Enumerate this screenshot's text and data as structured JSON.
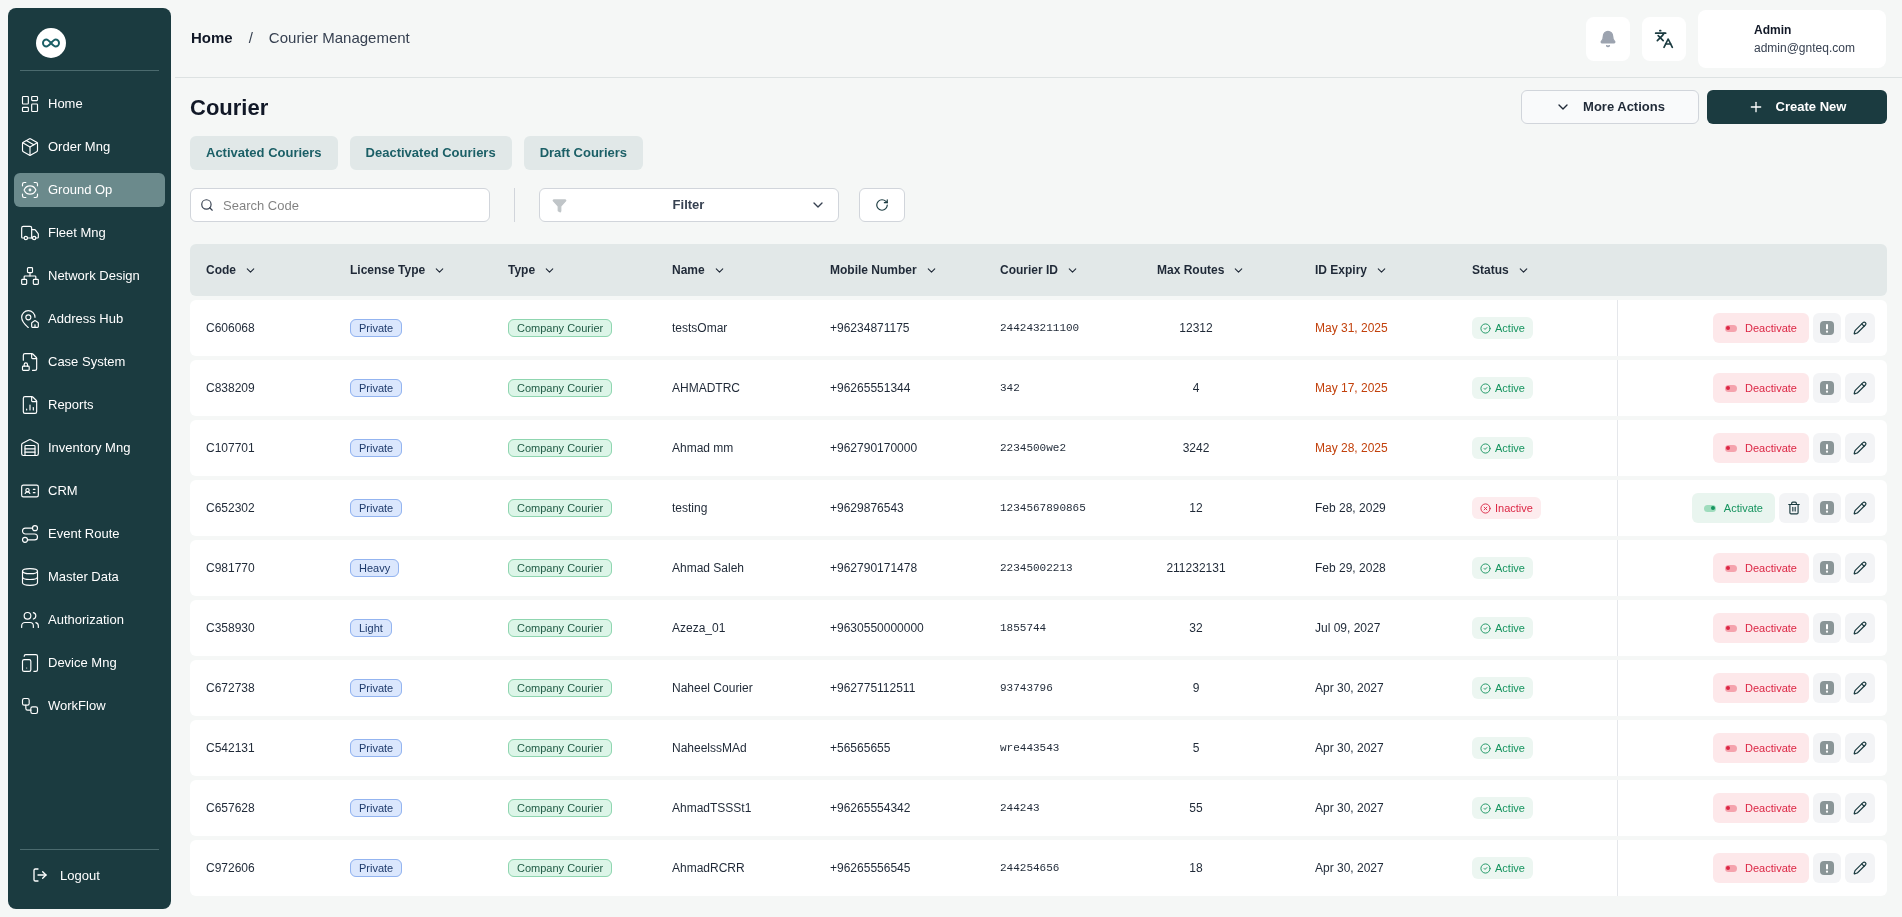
{
  "sidebar": {
    "items": [
      {
        "label": "Home",
        "selected": false
      },
      {
        "label": "Order Mng",
        "selected": false
      },
      {
        "label": "Ground Op",
        "selected": true
      },
      {
        "label": "Fleet Mng",
        "selected": false
      },
      {
        "label": "Network Design",
        "selected": false
      },
      {
        "label": "Address Hub",
        "selected": false
      },
      {
        "label": "Case System",
        "selected": false
      },
      {
        "label": "Reports",
        "selected": false
      },
      {
        "label": "Inventory Mng",
        "selected": false
      },
      {
        "label": "CRM",
        "selected": false
      },
      {
        "label": "Event Route",
        "selected": false
      },
      {
        "label": "Master Data",
        "selected": false
      },
      {
        "label": "Authorization",
        "selected": false
      },
      {
        "label": "Device Mng",
        "selected": false
      },
      {
        "label": "WorkFlow",
        "selected": false
      }
    ],
    "logout": "Logout"
  },
  "breadcrumb": [
    "Home",
    "Courier Management"
  ],
  "breadcrumb_separator": "/",
  "user": {
    "name": "Admin",
    "email": "admin@gnteq.com"
  },
  "page_title": "Courier",
  "more_actions": "More Actions",
  "create_new": "Create New",
  "filter_tabs": [
    "Activated Couriers",
    "Deactivated Couriers",
    "Draft Couriers"
  ],
  "search": {
    "placeholder": "Search Code"
  },
  "filter": "Filter",
  "table": {
    "columns": [
      "Code",
      "License Type",
      "Type",
      "Name",
      "Mobile Number",
      "Courier ID",
      "Max Routes",
      "ID Expiry",
      "Status"
    ],
    "rows": [
      {
        "code": "C606068",
        "license": "Private",
        "type": "Company Courier",
        "name": "testsOmar",
        "mobile": "+96234871175",
        "courier_id": "244243211100",
        "max_routes": "12312",
        "expiry": "May 31, 2025",
        "expired": true,
        "status": "Active",
        "active": true,
        "action": "Deactivate"
      },
      {
        "code": "C838209",
        "license": "Private",
        "type": "Company Courier",
        "name": "AHMADTRC",
        "mobile": "+96265551344",
        "courier_id": "342",
        "max_routes": "4",
        "expiry": "May 17, 2025",
        "expired": true,
        "status": "Active",
        "active": true,
        "action": "Deactivate"
      },
      {
        "code": "C107701",
        "license": "Private",
        "type": "Company Courier",
        "name": "Ahmad mm",
        "mobile": "+962790170000",
        "courier_id": "2234500we2",
        "max_routes": "3242",
        "expiry": "May 28, 2025",
        "expired": true,
        "status": "Active",
        "active": true,
        "action": "Deactivate"
      },
      {
        "code": "C652302",
        "license": "Private",
        "type": "Company Courier",
        "name": "testing",
        "mobile": "+9629876543",
        "courier_id": "1234567890865",
        "max_routes": "12",
        "expiry": "Feb 28, 2029",
        "expired": false,
        "status": "Inactive",
        "active": false,
        "action": "Activate"
      },
      {
        "code": "C981770",
        "license": "Heavy",
        "type": "Company Courier",
        "name": "Ahmad Saleh",
        "mobile": "+962790171478",
        "courier_id": "22345002213",
        "max_routes": "211232131",
        "expiry": "Feb 29, 2028",
        "expired": false,
        "status": "Active",
        "active": true,
        "action": "Deactivate"
      },
      {
        "code": "C358930",
        "license": "Light",
        "type": "Company Courier",
        "name": "Azeza_01",
        "mobile": "+9630550000000",
        "courier_id": "1855744",
        "max_routes": "32",
        "expiry": "Jul 09, 2027",
        "expired": false,
        "status": "Active",
        "active": true,
        "action": "Deactivate"
      },
      {
        "code": "C672738",
        "license": "Private",
        "type": "Company Courier",
        "name": "Naheel Courier",
        "mobile": "+962775112511",
        "courier_id": "93743796",
        "max_routes": "9",
        "expiry": "Apr 30, 2027",
        "expired": false,
        "status": "Active",
        "active": true,
        "action": "Deactivate"
      },
      {
        "code": "C542131",
        "license": "Private",
        "type": "Company Courier",
        "name": "NaheelssMAd",
        "mobile": "+56565655",
        "courier_id": "wre443543",
        "max_routes": "5",
        "expiry": "Apr 30, 2027",
        "expired": false,
        "status": "Active",
        "active": true,
        "action": "Deactivate"
      },
      {
        "code": "C657628",
        "license": "Private",
        "type": "Company Courier",
        "name": "AhmadTSSSt1",
        "mobile": "+96265554342",
        "courier_id": "244243",
        "max_routes": "55",
        "expiry": "Apr 30, 2027",
        "expired": false,
        "status": "Active",
        "active": true,
        "action": "Deactivate"
      },
      {
        "code": "C972606",
        "license": "Private",
        "type": "Company Courier",
        "name": "AhmadRCRR",
        "mobile": "+96265556545",
        "courier_id": "244254656",
        "max_routes": "18",
        "expiry": "Apr 30, 2027",
        "expired": false,
        "status": "Active",
        "active": true,
        "action": "Deactivate"
      }
    ]
  }
}
